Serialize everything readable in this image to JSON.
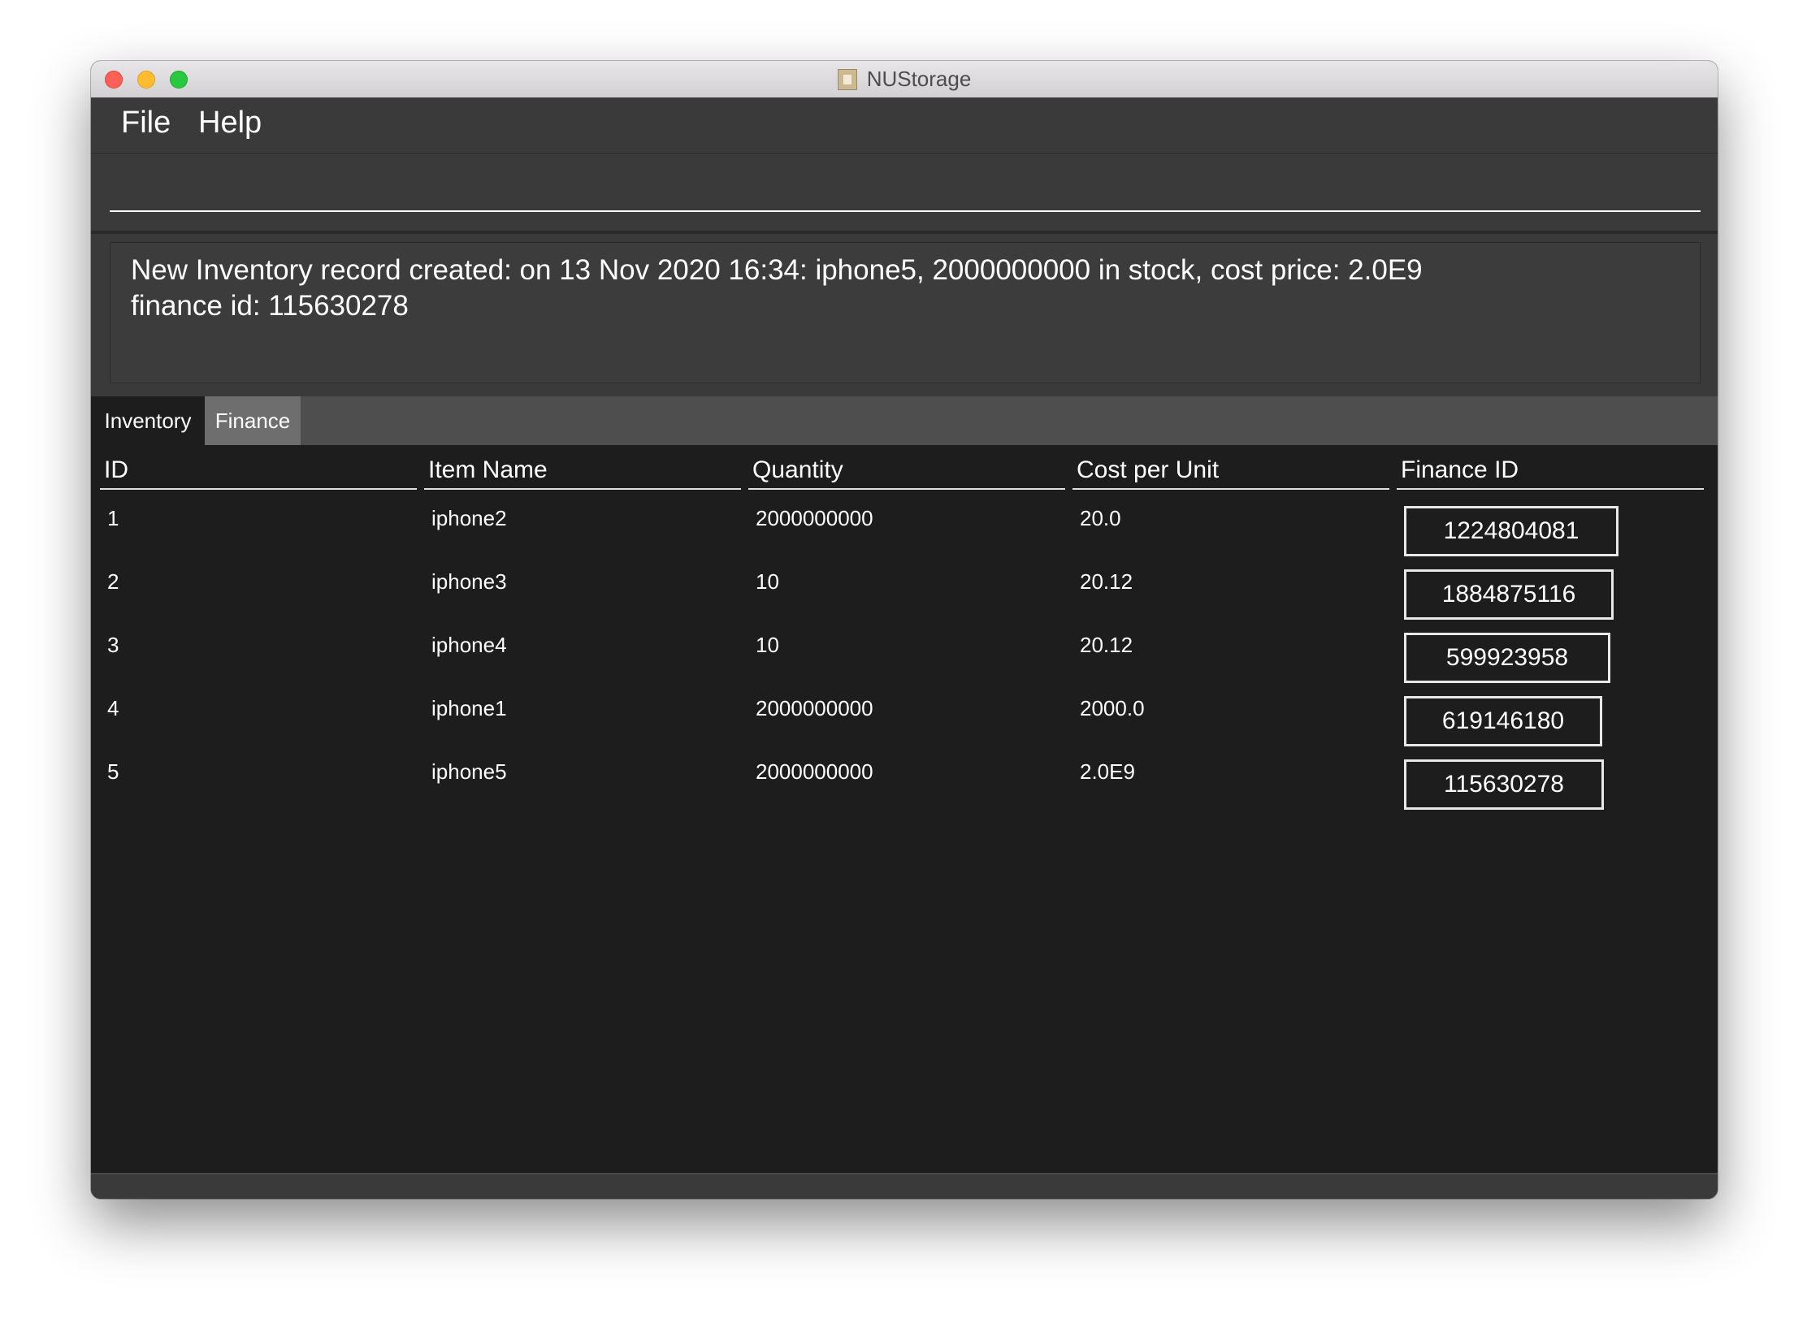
{
  "window": {
    "title": "NUStorage"
  },
  "menu": {
    "file_label": "File",
    "help_label": "Help"
  },
  "command": {
    "value": "",
    "placeholder": ""
  },
  "result": {
    "line1": "New Inventory record created: on 13 Nov 2020 16:34: iphone5, 2000000000 in stock, cost price: 2.0E9",
    "line2": "finance id: 115630278"
  },
  "tabs": [
    {
      "label": "Inventory",
      "selected": true
    },
    {
      "label": "Finance",
      "selected": false
    }
  ],
  "table": {
    "columns": [
      "ID",
      "Item Name",
      "Quantity",
      "Cost per Unit",
      "Finance ID"
    ],
    "rows": [
      {
        "id": "1",
        "name": "iphone2",
        "quantity": "2000000000",
        "cost": "20.0",
        "finance_id": "1224804081"
      },
      {
        "id": "2",
        "name": "iphone3",
        "quantity": "10",
        "cost": "20.12",
        "finance_id": "1884875116"
      },
      {
        "id": "3",
        "name": "iphone4",
        "quantity": "10",
        "cost": "20.12",
        "finance_id": "599923958"
      },
      {
        "id": "4",
        "name": "iphone1",
        "quantity": "2000000000",
        "cost": "2000.0",
        "finance_id": "619146180"
      },
      {
        "id": "5",
        "name": "iphone5",
        "quantity": "2000000000",
        "cost": "2.0E9",
        "finance_id": "115630278"
      }
    ]
  },
  "colors": {
    "background": "#1d1d1d",
    "panel": "#3a3a3a",
    "text": "#ffffff",
    "tab_selected": "#1d1d1d",
    "tab_unselected": "#6e6e6e"
  }
}
